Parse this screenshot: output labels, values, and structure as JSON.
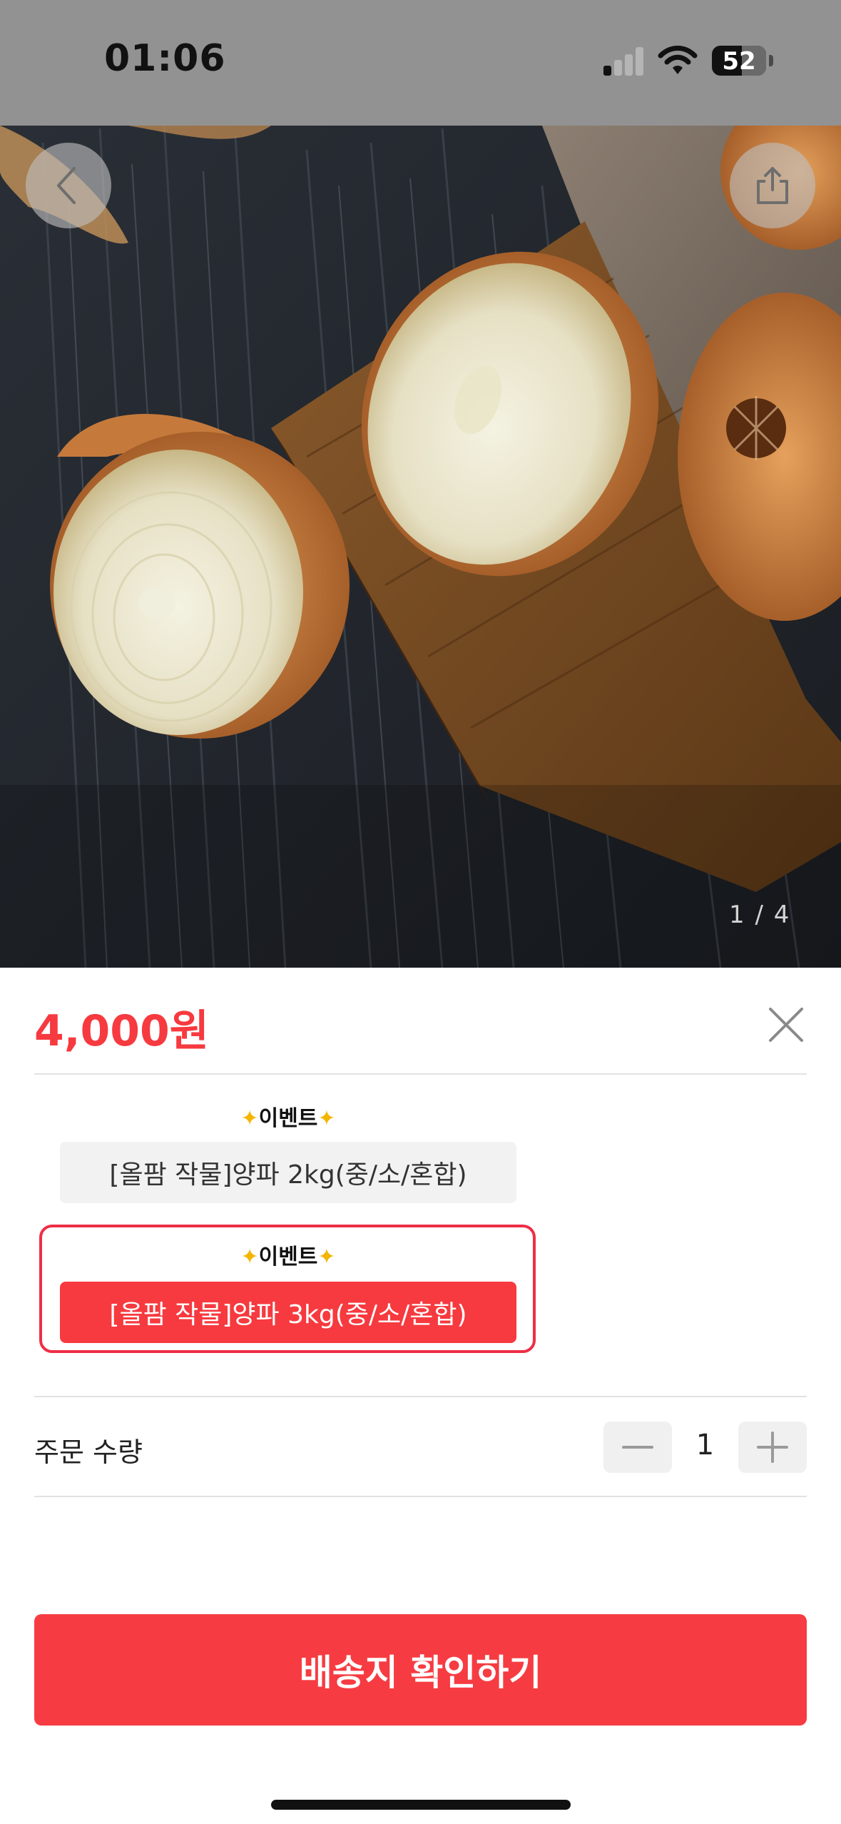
{
  "status_bar": {
    "time": "01:06",
    "battery": "52"
  },
  "gallery": {
    "page_indicator": "1 / 4",
    "image_icon": "product-photo-onions"
  },
  "icons": {
    "back": "back-icon",
    "share": "share-icon",
    "close": "close-icon",
    "minus": "minus-icon",
    "plus": "plus-icon"
  },
  "product": {
    "price": "4,000원"
  },
  "options": [
    {
      "event_label": "이벤트",
      "label": "[올팜 작물]양파 2kg(중/소/혼합)",
      "selected": false
    },
    {
      "event_label": "이벤트",
      "label": "[올팜 작물]양파 3kg(중/소/혼합)",
      "selected": true
    }
  ],
  "quantity": {
    "label": "주문 수량",
    "value": "1"
  },
  "cta": {
    "label": "배송지 확인하기"
  },
  "colors": {
    "accent": "#f63a3f",
    "highlight_border": "#ee2e47"
  }
}
